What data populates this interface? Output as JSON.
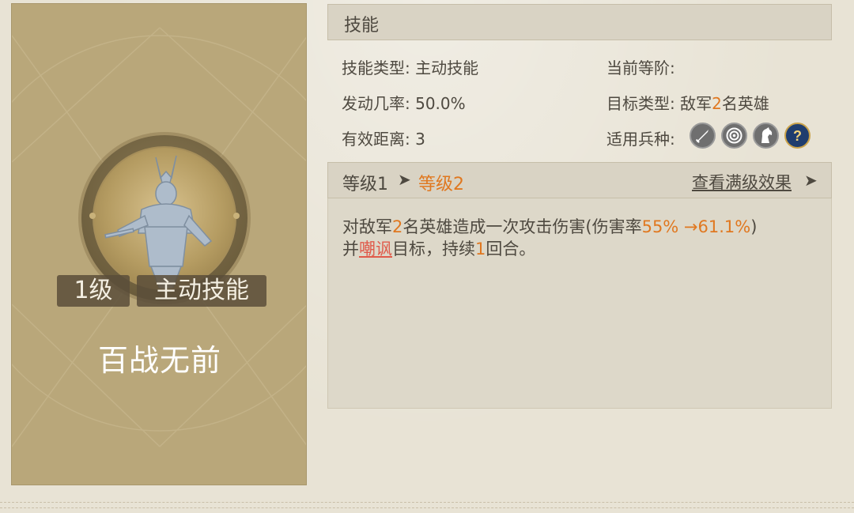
{
  "skill_card": {
    "level_badge": "1级",
    "type_badge": "主动技能",
    "name": "百战无前"
  },
  "section": {
    "title": "技能"
  },
  "info": {
    "skill_type_label": "技能类型:",
    "skill_type_value": "主动技能",
    "current_rank_label": "当前等阶:",
    "trigger_rate_label": "发动几率:",
    "trigger_rate_value": "50.0%",
    "target_type_label": "目标类型:",
    "target_type_prefix": "敌军",
    "target_type_count": "2",
    "target_type_suffix": "名英雄",
    "range_label": "有效距离:",
    "range_value": "3",
    "troop_label": "适用兵种:"
  },
  "troop_icons": [
    "sword-icon",
    "bow-target-icon",
    "horse-icon",
    "question-icon"
  ],
  "level_bar": {
    "current": "等级1",
    "arrow": "➤",
    "next": "等级2",
    "view_max": "查看满级效果",
    "view_arrow": "➤"
  },
  "description": {
    "line1_a": "对敌军",
    "line1_count": "2",
    "line1_b": "名英雄造成一次攻击伤害(伤害率",
    "line1_rate": "55% →61.1%",
    "line1_c": ")",
    "line2_a": "并",
    "line2_effect": "嘲讽",
    "line2_b": "目标，持续",
    "line2_turns": "1",
    "line2_c": "回合。"
  },
  "colors": {
    "highlight": "#e07820",
    "effect": "#e05a4a",
    "card": "#b9a77a",
    "text": "#4e4940"
  }
}
